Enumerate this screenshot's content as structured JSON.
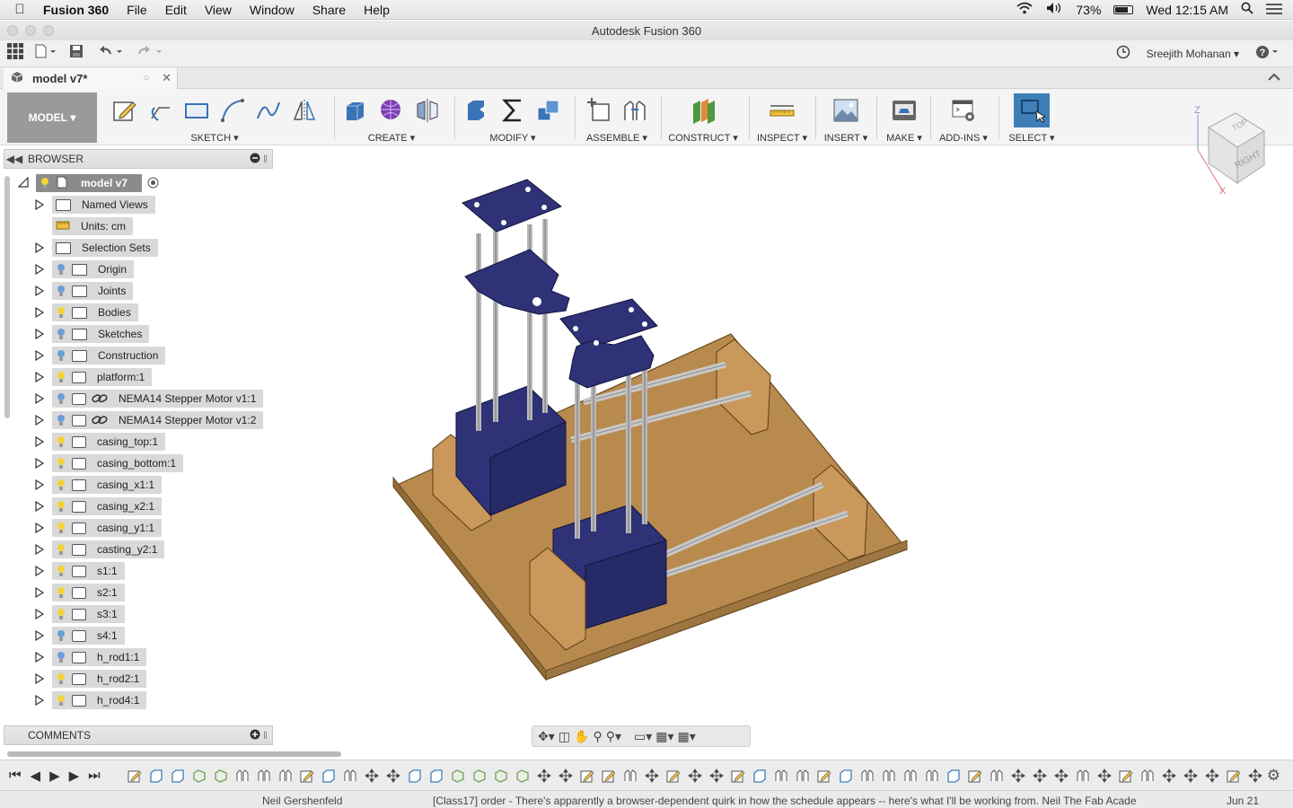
{
  "menubar": {
    "app": "Fusion 360",
    "items": [
      "File",
      "Edit",
      "View",
      "Window",
      "Share",
      "Help"
    ],
    "battery": "73%",
    "clock": "Wed 12:15 AM"
  },
  "window": {
    "title": "Autodesk Fusion 360"
  },
  "qab": {
    "user": "Sreejith Mohanan"
  },
  "doc_tab": {
    "label": "model v7*"
  },
  "ribbon": {
    "workspace": "MODEL",
    "groups": [
      "SKETCH",
      "CREATE",
      "MODIFY",
      "ASSEMBLE",
      "CONSTRUCT",
      "INSPECT",
      "INSERT",
      "MAKE",
      "ADD-INS",
      "SELECT"
    ]
  },
  "viewcube": {
    "top": "TOP",
    "right": "RIGHT",
    "axis_z": "Z",
    "axis_x": "X"
  },
  "browser": {
    "title": "BROWSER",
    "root": "model v7",
    "items": [
      "Named Views",
      "Units: cm",
      "Selection Sets",
      "Origin",
      "Joints",
      "Bodies",
      "Sketches",
      "Construction",
      "platform:1",
      "NEMA14 Stepper Motor v1:1",
      "NEMA14 Stepper Motor v1:2",
      "casing_top:1",
      "casing_bottom:1",
      "casing_x1:1",
      "casing_x2:1",
      "casing_y1:1",
      "casting_y2:1",
      "s1:1",
      "s2:1",
      "s3:1",
      "s4:1",
      "h_rod1:1",
      "h_rod2:1",
      "h_rod4:1"
    ]
  },
  "comments": {
    "title": "COMMENTS"
  },
  "mail": {
    "sender": "Neil Gershenfeld",
    "subject": "[Class17] order - There's apparently a browser-dependent quirk in how the schedule appears -- here's what I'll be working from. Neil The Fab Acade",
    "date": "Jun 21"
  },
  "colors": {
    "wood": "#b88a4e",
    "plate": "#2f3277",
    "select_blue": "#3f7fb8",
    "bulb_on": "#f2d33a",
    "bulb_off": "#6b9fd6"
  }
}
